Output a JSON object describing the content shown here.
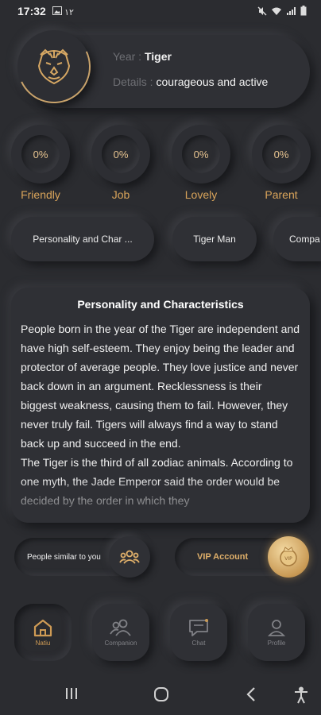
{
  "status_bar": {
    "time": "17:32",
    "extra": "۱۲"
  },
  "profile": {
    "year_label": "Year :",
    "year_value": "Tiger",
    "details_label": "Details :",
    "details_value": "courageous and active"
  },
  "metrics": [
    {
      "value": "0%",
      "label": "Friendly"
    },
    {
      "value": "0%",
      "label": "Job"
    },
    {
      "value": "0%",
      "label": "Lovely"
    },
    {
      "value": "0%",
      "label": "Parent"
    }
  ],
  "tabs": [
    "Personality and Char ...",
    "Tiger Man",
    "Compa"
  ],
  "content": {
    "title": "Personality and Characteristics",
    "body": "People born in the year of the Tiger are independent and have high self-esteem. They enjoy being the leader and protector of average people. They love justice and never back down in an argument. Recklessness is their biggest weakness, causing them to fail. However, they never truly fail. Tigers will always find a way to stand back up and succeed in the end.\nThe Tiger is the third of all zodiac animals. According to one myth, the Jade Emperor said the order would be decided by the order in which they"
  },
  "actions": {
    "similar_label": "People similar to you",
    "vip_label": "VIP Account"
  },
  "bottom_nav": [
    {
      "label": "Natiu",
      "icon": "home-icon"
    },
    {
      "label": "Companion",
      "icon": "people-icon"
    },
    {
      "label": "Chat",
      "icon": "chat-icon"
    },
    {
      "label": "Profile",
      "icon": "person-icon"
    }
  ],
  "colors": {
    "accent": "#d9a45a",
    "background": "#2b2c30"
  }
}
